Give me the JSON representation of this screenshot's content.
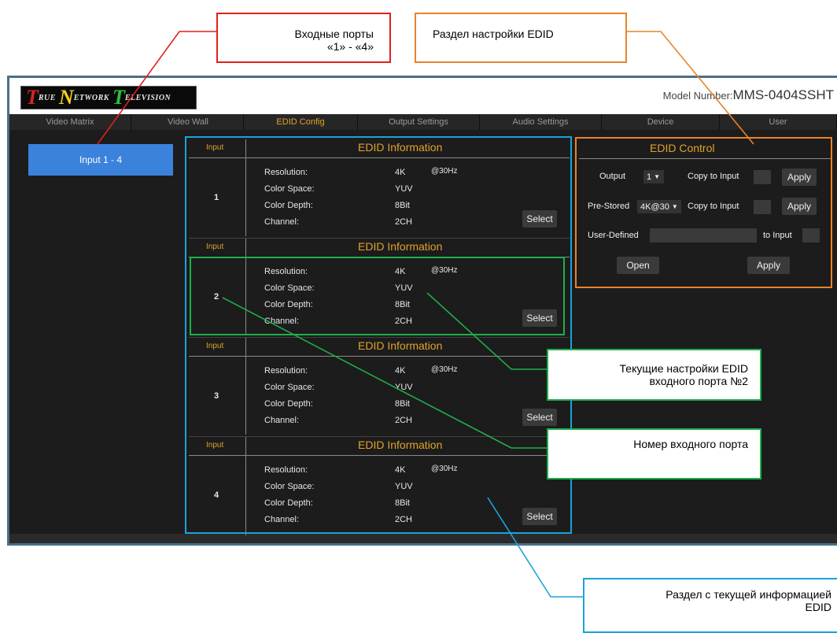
{
  "callouts": {
    "input_ports_line1": "Входные порты",
    "input_ports_line2": "«1» - «4»",
    "edid_section": "Раздел настройки EDID",
    "current_edid_line1": "Текущие настройки EDID",
    "current_edid_line2": "входного порта №2",
    "port_number": "Номер входного порта",
    "current_info_line1": "Раздел с текущей информацией",
    "current_info_line2": "EDID"
  },
  "header": {
    "logo_letters": [
      "T",
      "N",
      "T"
    ],
    "logo_words": [
      "RUE",
      "ETWORK",
      "ELEVISION"
    ],
    "model_label": "Model Number:",
    "model_value": "MMS-0404SSHT"
  },
  "nav": {
    "tabs": [
      "Video Matrix",
      "Video Wall",
      "EDID Config",
      "Output Settings",
      "Audio Settings",
      "Device",
      "User"
    ],
    "active": "EDID Config"
  },
  "sidebar": {
    "item": "Input 1 - 4"
  },
  "edid": {
    "input_header": "Input",
    "info_header": "EDID Information",
    "field_labels": [
      "Resolution:",
      "Color Space:",
      "Color Depth:",
      "Channel:"
    ],
    "select_label": "Select",
    "ports": [
      {
        "number": "1",
        "resolution": "4K",
        "rate": "@30Hz",
        "color_space": "YUV",
        "color_depth": "8Bit",
        "channel": "2CH"
      },
      {
        "number": "2",
        "resolution": "4K",
        "rate": "@30Hz",
        "color_space": "YUV",
        "color_depth": "8Bit",
        "channel": "2CH"
      },
      {
        "number": "3",
        "resolution": "4K",
        "rate": "@30Hz",
        "color_space": "YUV",
        "color_depth": "8Bit",
        "channel": "2CH"
      },
      {
        "number": "4",
        "resolution": "4K",
        "rate": "@30Hz",
        "color_space": "YUV",
        "color_depth": "8Bit",
        "channel": "2CH"
      }
    ]
  },
  "control": {
    "title": "EDID Control",
    "output_label": "Output",
    "output_value": "1",
    "copy_to_input": "Copy to Input",
    "apply": "Apply",
    "prestored_label": "Pre-Stored",
    "prestored_value": "4K@30",
    "user_defined_label": "User-Defined",
    "to_input": "to Input",
    "open": "Open"
  },
  "colors": {
    "accent": "#e2a22a",
    "red": "#e0201c",
    "orange": "#e8832a",
    "green": "#1fae4c",
    "blue": "#19a3dc"
  }
}
